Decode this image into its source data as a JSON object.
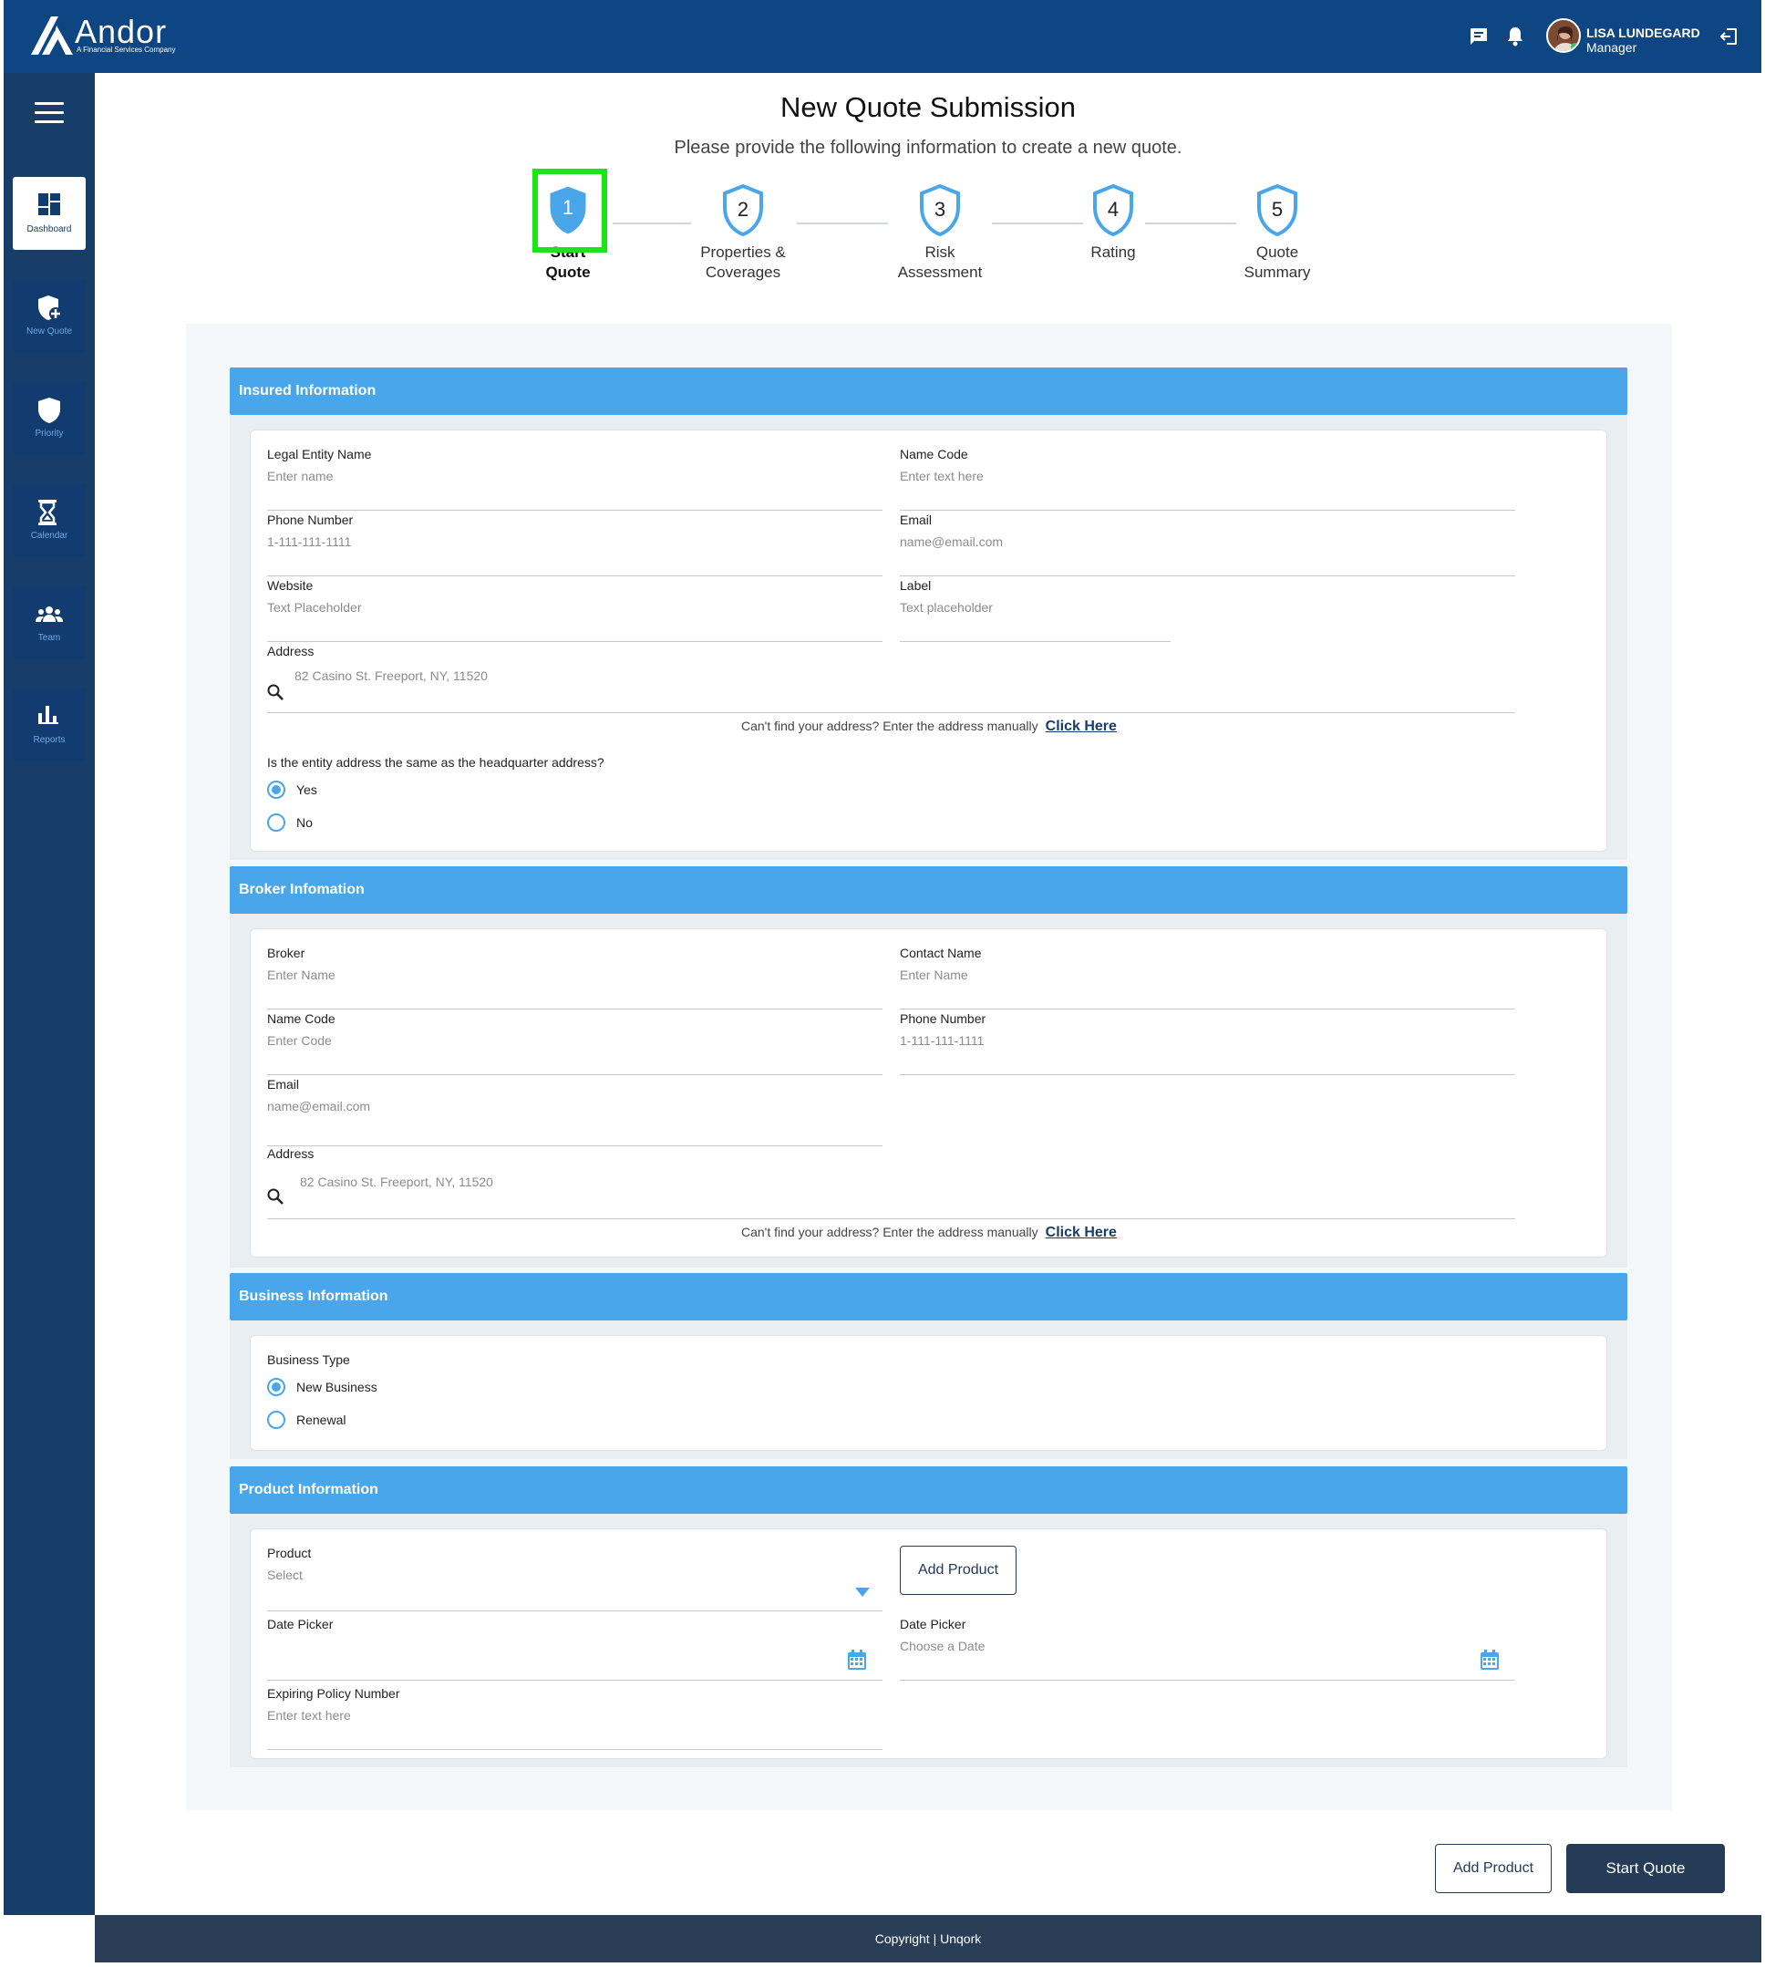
{
  "header": {
    "logo_text": "Andor",
    "logo_subtitle": "A Financial Services Company",
    "user_name": "LISA LUNDEGARD",
    "user_role": "Manager",
    "icons": [
      "chat-icon",
      "bell-icon",
      "logout-icon"
    ]
  },
  "sidebar": {
    "items": [
      {
        "label": "Dashboard",
        "icon": "dashboard-icon",
        "active": true
      },
      {
        "label": "New Quote",
        "icon": "shield-plus-icon",
        "active": false
      },
      {
        "label": "Priority",
        "icon": "shield-icon",
        "active": false
      },
      {
        "label": "Calendar",
        "icon": "hourglass-icon",
        "active": false
      },
      {
        "label": "Team",
        "icon": "team-icon",
        "active": false
      },
      {
        "label": "Reports",
        "icon": "bar-chart-icon",
        "active": false
      }
    ]
  },
  "page": {
    "title": "New Quote Submission",
    "subtitle": "Please provide the following information to create a new quote."
  },
  "steps": [
    {
      "number": "1",
      "label_line1": "Start",
      "label_line2": "Quote",
      "active": true
    },
    {
      "number": "2",
      "label_line1": "Properties &",
      "label_line2": "Coverages",
      "active": false
    },
    {
      "number": "3",
      "label_line1": "Risk",
      "label_line2": "Assessment",
      "active": false
    },
    {
      "number": "4",
      "label_line1": "Rating",
      "label_line2": "",
      "active": false
    },
    {
      "number": "5",
      "label_line1": "Quote",
      "label_line2": "Summary",
      "active": false
    }
  ],
  "insured": {
    "title": "Insured Information",
    "legal_entity_label": "Legal Entity Name",
    "legal_entity_placeholder": "Enter name",
    "name_code_label": "Name Code",
    "name_code_placeholder": "Enter text here",
    "phone_label": "Phone Number",
    "phone_placeholder": "1-111-111-1111",
    "email_label": "Email",
    "email_placeholder": "name@email.com",
    "website_label": "Website",
    "website_placeholder": "Text Placeholder",
    "label_label": "Label",
    "label_placeholder": "Text placeholder",
    "address_label": "Address",
    "address_placeholder": "82 Casino St. Freeport, NY, 11520",
    "manual_text": "Can't find your address? Enter the address manually",
    "click_here": "Click Here",
    "hq_question": "Is the entity address the same as the headquarter address?",
    "hq_options": [
      "Yes",
      "No"
    ],
    "hq_selected": "Yes"
  },
  "broker": {
    "title": "Broker Infomation",
    "broker_label": "Broker",
    "broker_placeholder": "Enter Name",
    "contact_label": "Contact Name",
    "contact_placeholder": "Enter Name",
    "name_code_label": "Name Code",
    "name_code_placeholder": "Enter Code",
    "phone_label": "Phone Number",
    "phone_placeholder": "1-111-111-1111",
    "email_label": "Email",
    "email_placeholder": "name@email.com",
    "address_label": "Address",
    "address_placeholder": "82 Casino St. Freeport, NY, 11520",
    "manual_text": "Can't find your address? Enter the address manually",
    "click_here": "Click Here"
  },
  "business": {
    "title": "Business Information",
    "type_label": "Business Type",
    "options": [
      "New Business",
      "Renewal"
    ],
    "selected": "New Business"
  },
  "product": {
    "title": "Product Information",
    "product_label": "Product",
    "product_placeholder": "Select",
    "add_product": "Add Product",
    "date1_label": "Date Picker",
    "date1_placeholder": "",
    "date2_label": "Date Picker",
    "date2_placeholder": "Choose a Date",
    "expiring_label": "Expiring Policy Number",
    "expiring_placeholder": "Enter text here"
  },
  "actions": {
    "add_product": "Add Product",
    "start_quote": "Start Quote"
  },
  "footer": {
    "copyright": "Copyright | Unqork"
  },
  "colors": {
    "topbar": "#0e4583",
    "sidebar": "#173e6b",
    "section_header": "#4aa6ea",
    "primary_button": "#253c59",
    "highlight": "#1be41b"
  }
}
